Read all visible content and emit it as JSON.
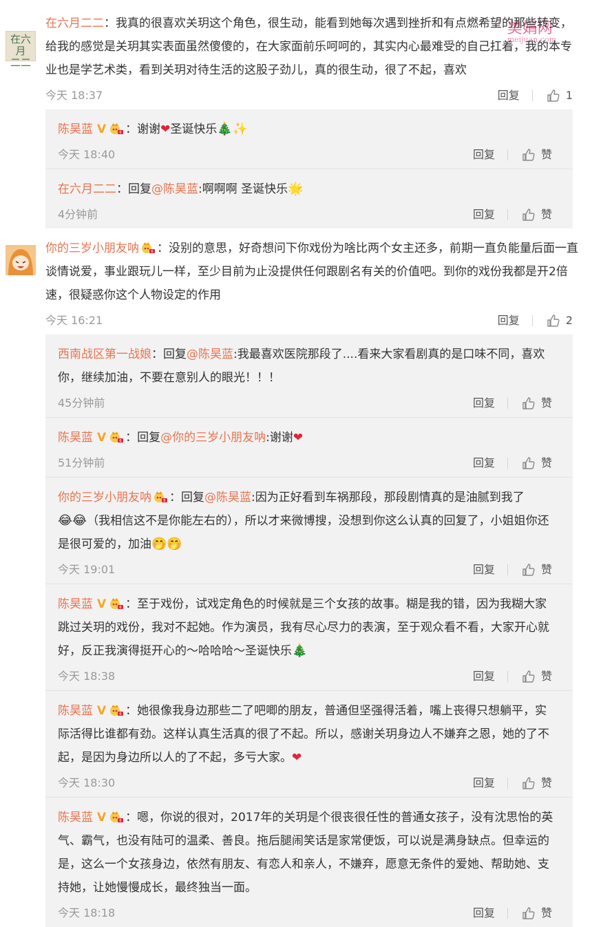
{
  "watermark": {
    "text": "美娟网",
    "sub": "meijuan.com"
  },
  "comments": [
    {
      "user": "在六月二二",
      "avatar_text": "在六月二二",
      "text": "：我真的很喜欢关玥这个角色，很生动，能看到她每次遇到挫折和有点燃希望的那些转变，给我的感觉是关玥其实表面虽然傻傻的，在大家面前乐呵呵的，其实内心最难受的自己扛着，我的本专业也是学艺术类，看到关玥对待生活的这股子劲儿，真的很生动，很了不起，喜欢",
      "time": "今天 18:37",
      "reply_label": "回复",
      "likes": "1",
      "replies": [
        {
          "user": "陈昊蓝",
          "pre": "：谢谢",
          "post": "圣诞快乐",
          "time": "今天 18:40",
          "reply_label": "回复",
          "like_label": "赞"
        },
        {
          "user": "在六月二二",
          "pre": "：回复",
          "mention": "@陈昊蓝",
          "post": ":啊啊啊 圣诞快乐",
          "time": "4分钟前",
          "reply_label": "回复",
          "like_label": "赞"
        }
      ]
    },
    {
      "user": "你的三岁小朋友呐",
      "text": "：没别的意思，好奇想问下你戏份为啥比两个女主还多，前期一直负能量后面一直谈情说爱，事业跟玩儿一样，至少目前为止没提供任何跟剧名有关的价值吧。到你的戏份我都是开2倍速，很疑惑你这个人物设定的作用",
      "time": "今天 16:21",
      "reply_label": "回复",
      "likes": "2",
      "replies": [
        {
          "user": "西南战区第一战娘",
          "pre": "：回复",
          "mention": "@陈昊蓝",
          "post": ":我最喜欢医院那段了....看来大家看剧真的是口味不同，喜欢你，继续加油，不要在意别人的眼光！！！",
          "time": "45分钟前",
          "reply_label": "回复",
          "like_label": "赞"
        },
        {
          "user": "陈昊蓝",
          "pre": "：回复",
          "mention": "@你的三岁小朋友呐",
          "post": ":谢谢",
          "time": "51分钟前",
          "reply_label": "回复",
          "like_label": "赞"
        },
        {
          "user": "你的三岁小朋友呐",
          "pre": "：回复",
          "mention": "@陈昊蓝",
          "post": ":因为正好看到车祸那段，那段剧情真的是油腻到我了",
          "post2": "（我相信这不是你能左右的），所以才来微博搜，没想到你这么认真的回复了，小姐姐你还是很可爱的，加油",
          "time": "今天 19:01",
          "reply_label": "回复",
          "like_label": "赞"
        },
        {
          "user": "陈昊蓝",
          "pre": "：至于戏份，试戏定角色的时候就是三个女孩的故事。糊是我的错，因为我糊大家跳过关玥的戏份，我对不起她。作为演员，我有尽心尽力的表演，至于观众看不看，大家开心就好，反正我演得挺开心的～哈哈哈～圣诞快乐",
          "time": "今天 18:38",
          "reply_label": "回复",
          "like_label": "赞"
        },
        {
          "user": "陈昊蓝",
          "pre": "：她很像我身边那些二了吧唧的朋友，普通但坚强得活着，嘴上丧得只想躺平，实际活得比谁都有劲。这样认真生活真的很了不起。所以，感谢关玥身边人不嫌弃之恩，她的了不起，是因为身边所以人的了不起，多亏大家。",
          "time": "今天 18:30",
          "reply_label": "回复",
          "like_label": "赞"
        },
        {
          "user": "陈昊蓝",
          "pre": "：嗯，你说的很对，2017年的关玥是个很丧很任性的普通女孩子，没有沈思怡的英气、霸气，也没有陆可的温柔、善良。拖后腿闹笑话是家常便饭，可以说是满身缺点。但幸运的是，这么一个女孩身边，依然有朋友、有恋人和亲人，不嫌弃，愿意无条件的爱她、帮助她、支持她，让她慢慢成长，最终独当一面。",
          "time": "今天 18:18",
          "reply_label": "回复",
          "like_label": "赞"
        }
      ]
    }
  ]
}
